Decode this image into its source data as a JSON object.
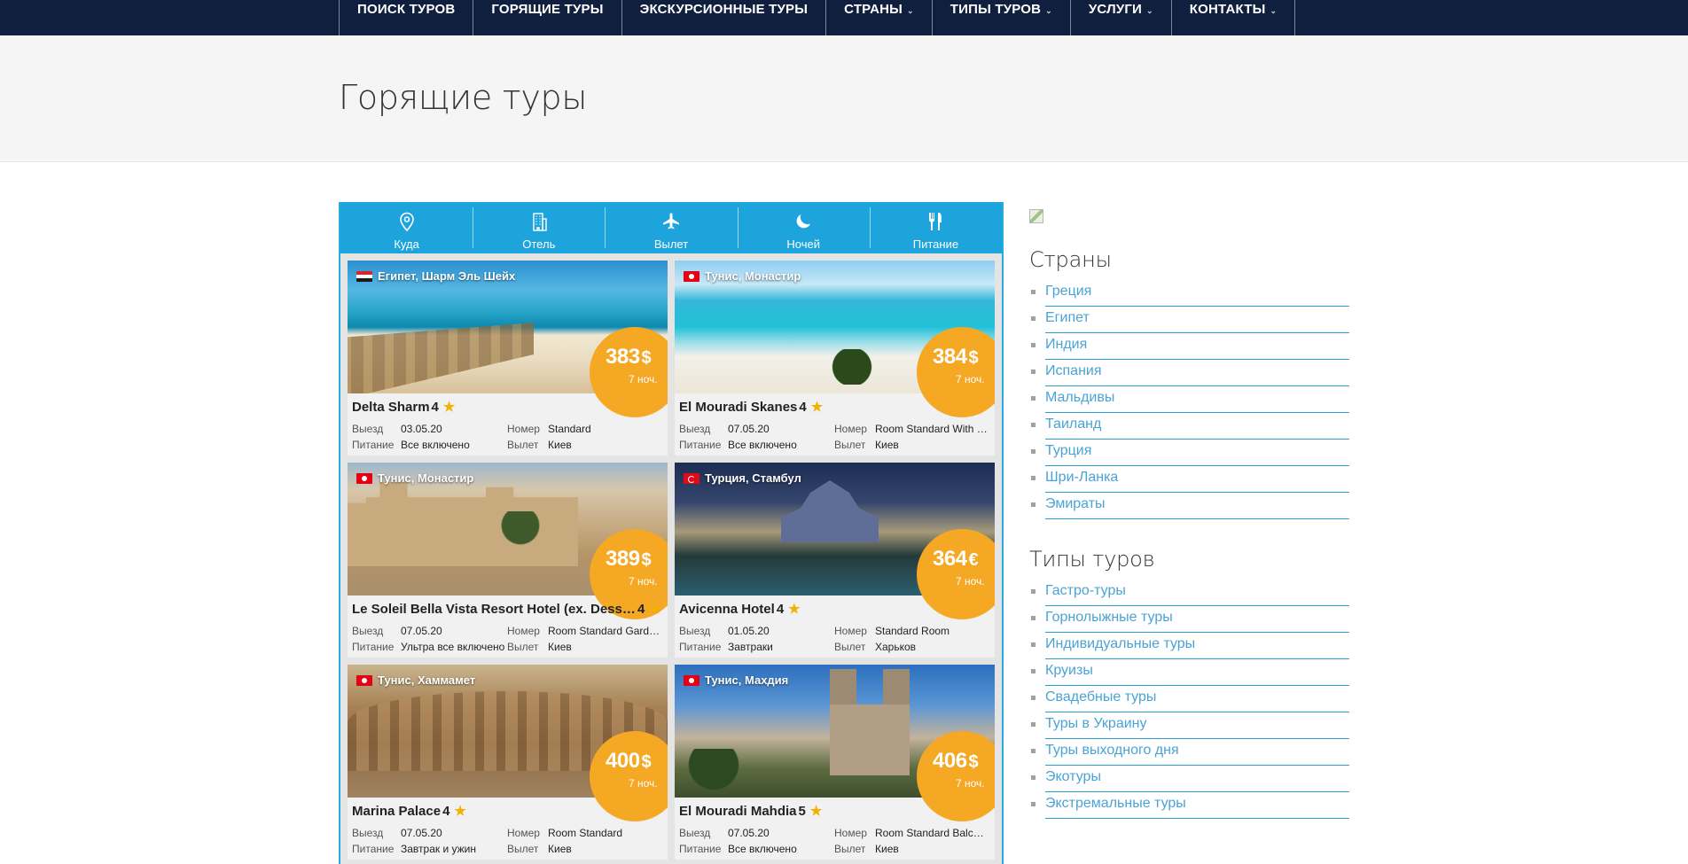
{
  "nav": {
    "items": [
      {
        "label": "ПОИСК ТУРОВ",
        "dropdown": false
      },
      {
        "label": "ГОРЯЩИЕ ТУРЫ",
        "dropdown": false
      },
      {
        "label": "ЭКСКУРСИОННЫЕ ТУРЫ",
        "dropdown": false
      },
      {
        "label": "СТРАНЫ",
        "dropdown": true
      },
      {
        "label": "ТИПЫ ТУРОВ",
        "dropdown": true
      },
      {
        "label": "УСЛУГИ",
        "dropdown": true
      },
      {
        "label": "КОНТАКТЫ",
        "dropdown": true
      }
    ],
    "caret": "⌄"
  },
  "page": {
    "title": "Горящие туры"
  },
  "filters": [
    {
      "label": "Куда",
      "icon": "map-pin-icon"
    },
    {
      "label": "Отель",
      "icon": "hotel-building-icon"
    },
    {
      "label": "Вылет",
      "icon": "airplane-icon"
    },
    {
      "label": "Ночей",
      "icon": "moon-icon"
    },
    {
      "label": "Питание",
      "icon": "fork-knife-icon"
    }
  ],
  "labels": {
    "departure": "Выезд",
    "food": "Питание",
    "room": "Номер",
    "flight": "Вылет"
  },
  "tours": [
    {
      "location": "Египет, Шарм Эль Шейх",
      "flag": "eg",
      "price": "383",
      "currency": "$",
      "nights": "7 ноч.",
      "hotel": "Delta Sharm",
      "stars": "4",
      "departure": "03.05.20",
      "food": "Все включено",
      "room": "Standard",
      "flight": "Киев",
      "photo": "beach"
    },
    {
      "location": "Тунис, Монастир",
      "flag": "tn",
      "price": "384",
      "currency": "$",
      "nights": "7 ноч.",
      "hotel": "El Mouradi Skanes",
      "stars": "4",
      "departure": "07.05.20",
      "food": "Все включено",
      "room": "Room Standard With Sea View",
      "flight": "Киев",
      "photo": "lagoon"
    },
    {
      "location": "Тунис, Монастир",
      "flag": "tn",
      "price": "389",
      "currency": "$",
      "nights": "7 ноч.",
      "hotel": "Le Soleil Bella Vista Resort Hotel (ex. Dessole Bella Vista)",
      "stars": "4",
      "departure": "07.05.20",
      "food": "Ультра все включено",
      "room": "Room Standard Garden View",
      "flight": "Киев",
      "photo": "fortress"
    },
    {
      "location": "Турция, Стамбул",
      "flag": "tr",
      "price": "364",
      "currency": "€",
      "nights": "7 ноч.",
      "hotel": "Avicenna Hotel",
      "stars": "4",
      "departure": "01.05.20",
      "food": "Завтраки",
      "room": "Standard Room",
      "flight": "Харьков",
      "photo": "mosque"
    },
    {
      "location": "Тунис, Хаммамет",
      "flag": "tn",
      "price": "400",
      "currency": "$",
      "nights": "7 ноч.",
      "hotel": "Marina Palace",
      "stars": "4",
      "departure": "07.05.20",
      "food": "Завтрак и ужин",
      "room": "Room Standard",
      "flight": "Киев",
      "photo": "colosseum"
    },
    {
      "location": "Тунис, Махдия",
      "flag": "tn",
      "price": "406",
      "currency": "$",
      "nights": "7 ноч.",
      "hotel": "El Mouradi Mahdia",
      "stars": "5",
      "departure": "07.05.20",
      "food": "Все включено",
      "room": "Room Standard Balcony",
      "flight": "Киев",
      "photo": "cathedral"
    }
  ],
  "sidebar": {
    "countries_title": "Страны",
    "countries": [
      "Греция",
      "Египет",
      "Индия",
      "Испания",
      "Мальдивы",
      "Таиланд",
      "Турция",
      "Шри-Ланка",
      "Эмираты"
    ],
    "types_title": "Типы туров",
    "types": [
      "Гастро-туры",
      "Горнолыжные туры",
      "Индивидуальные туры",
      "Круизы",
      "Свадебные туры",
      "Туры в Украину",
      "Туры выходного дня",
      "Экотуры",
      "Экстремальные туры"
    ]
  },
  "colors": {
    "nav_bg": "#0f1f3d",
    "accent_blue": "#1ea4dd",
    "price_orange": "#f4a824",
    "link_blue": "#4aa3d6",
    "star_yellow": "#f4b000"
  }
}
